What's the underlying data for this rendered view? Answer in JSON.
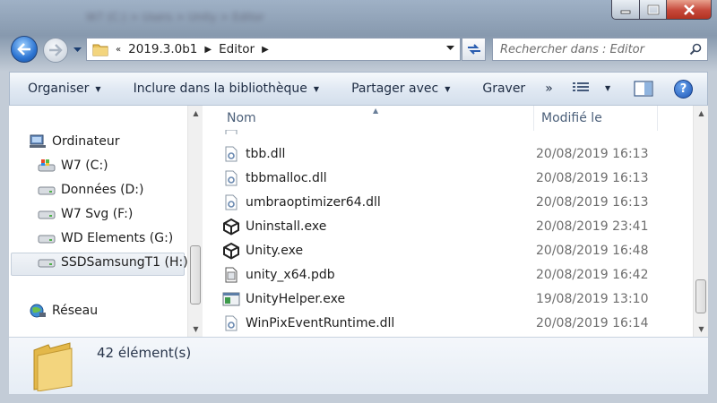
{
  "window": {
    "blurred_title": "W7 (C:) > Users > Unity > Editor"
  },
  "address": {
    "overflow": "«",
    "crumbs": [
      "2019.3.0b1",
      "Editor"
    ],
    "search_placeholder": "Rechercher dans : Editor"
  },
  "toolbar": {
    "organize": "Organiser",
    "include_library": "Inclure dans la bibliothèque",
    "share": "Partager avec",
    "burn": "Graver",
    "more": "»"
  },
  "nav": {
    "computer": "Ordinateur",
    "drives": [
      "W7 (C:)",
      "Données (D:)",
      "W7 Svg (F:)",
      "WD Elements (G:)",
      "SSDSamsungT1 (H:)"
    ],
    "network": "Réseau"
  },
  "columns": {
    "name": "Nom",
    "date": "Modifié le"
  },
  "files": [
    {
      "name": "tbb.dll",
      "date": "20/08/2019 16:13",
      "icon": "dll-icon"
    },
    {
      "name": "tbbmalloc.dll",
      "date": "20/08/2019 16:13",
      "icon": "dll-icon"
    },
    {
      "name": "umbraoptimizer64.dll",
      "date": "20/08/2019 16:13",
      "icon": "dll-icon"
    },
    {
      "name": "Uninstall.exe",
      "date": "20/08/2019 23:41",
      "icon": "unity-icon"
    },
    {
      "name": "Unity.exe",
      "date": "20/08/2019 16:48",
      "icon": "unity-icon"
    },
    {
      "name": "unity_x64.pdb",
      "date": "20/08/2019 16:42",
      "icon": "pdb-icon"
    },
    {
      "name": "UnityHelper.exe",
      "date": "19/08/2019 13:10",
      "icon": "exe-icon"
    },
    {
      "name": "WinPixEventRuntime.dll",
      "date": "20/08/2019 16:14",
      "icon": "dll-icon"
    }
  ],
  "status": {
    "count": "42 élément(s)"
  }
}
